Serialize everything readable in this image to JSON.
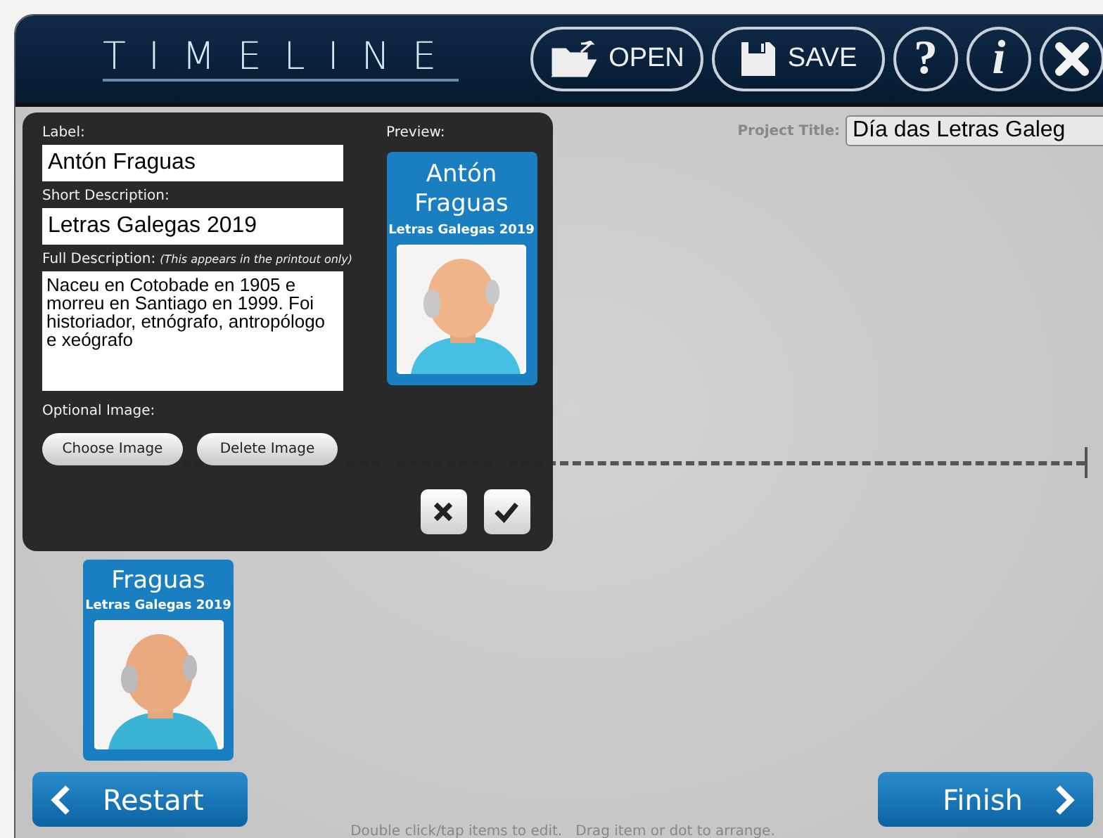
{
  "window": {
    "title": "TIMELINE"
  },
  "toolbar": [
    {
      "kind": "open",
      "label": "OPEN"
    },
    {
      "kind": "save",
      "label": "SAVE"
    },
    {
      "kind": "help",
      "label": "?"
    },
    {
      "kind": "info",
      "label": "i"
    },
    {
      "kind": "close"
    }
  ],
  "project_title": {
    "label": "Project Title:",
    "value": "Día das Letras Galeg"
  },
  "dialog": {
    "label_field": {
      "label": "Label:",
      "value": "Antón Fraguas"
    },
    "short_field": {
      "label": "Short Description:",
      "value": "Letras Galegas 2019"
    },
    "full_field": {
      "label": "Full Description:",
      "note": "(This appears in the printout only)",
      "value": "Naceu en Cotobade en 1905 e morreu en Santiago en 1999. Foi historiador, etnógrafo, antropólogo e xeógrafo"
    },
    "image_label": "Optional Image:",
    "image_buttons": [
      "Choose Image",
      "Delete Image"
    ],
    "preview": {
      "label": "Preview:",
      "title": "Antón Fraguas",
      "subtitle": "Letras Galegas 2019"
    }
  },
  "timeline_card": {
    "title": "Fraguas",
    "subtitle": "Letras Galegas 2019"
  },
  "footer": {
    "restart": "Restart",
    "finish": "Finish",
    "hint": "Double click/tap items to edit.   Drag item or dot to arrange."
  }
}
